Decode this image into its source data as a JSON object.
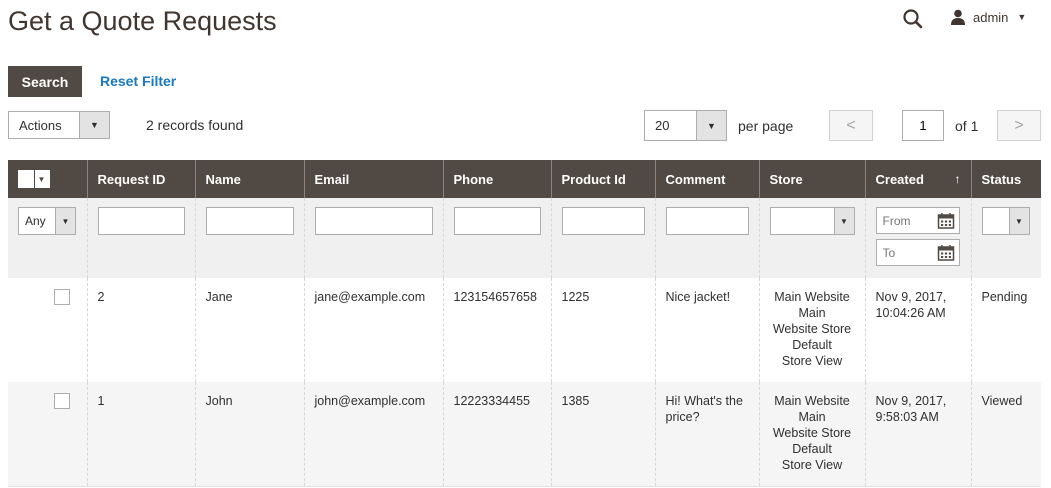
{
  "header": {
    "title": "Get a Quote Requests",
    "user_name": "admin"
  },
  "toolbar": {
    "search_label": "Search",
    "reset_filter_label": "Reset Filter",
    "actions_label": "Actions",
    "records_found": "2 records found",
    "per_page_value": "20",
    "per_page_label": "per page",
    "prev_label": "<",
    "next_label": ">",
    "page_value": "1",
    "of_label": "of 1"
  },
  "grid": {
    "columns": [
      "Request ID",
      "Name",
      "Email",
      "Phone",
      "Product Id",
      "Comment",
      "Store",
      "Created",
      "Status"
    ],
    "sort_indicator": "↑",
    "filters": {
      "any_label": "Any",
      "from_placeholder": "From",
      "to_placeholder": "To"
    },
    "rows": [
      {
        "id": "2",
        "name": "Jane",
        "email": "jane@example.com",
        "phone": "123154657658",
        "product_id": "1225",
        "comment": "Nice jacket!",
        "store": [
          "Main Website",
          "Main",
          "Website Store",
          "Default",
          "Store View"
        ],
        "created": [
          "Nov 9, 2017,",
          "10:04:26 AM"
        ],
        "status": "Pending"
      },
      {
        "id": "1",
        "name": "John",
        "email": "john@example.com",
        "phone": "12223334455",
        "product_id": "1385",
        "comment": [
          "Hi! What's the",
          "price?"
        ],
        "store": [
          "Main Website",
          "Main",
          "Website Store",
          "Default",
          "Store View"
        ],
        "created": [
          "Nov 9, 2017,",
          "9:58:03 AM"
        ],
        "status": "Viewed"
      }
    ]
  },
  "icons": {
    "search": "search-icon",
    "user": "user-icon",
    "calendar": "calendar-icon",
    "dropdown": "chevron-down-icon"
  },
  "colors": {
    "header_bg": "#514943",
    "link": "#1979c3",
    "title": "#41362f"
  }
}
